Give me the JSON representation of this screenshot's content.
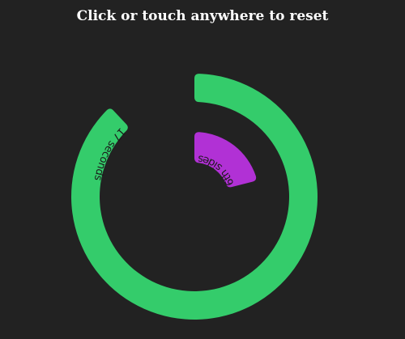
{
  "header": {
    "title": "Click or touch anywhere to reset"
  },
  "timer": {
    "outer_ring": {
      "label": "17 seconds",
      "seconds": 17,
      "progress_fraction": 0.88,
      "color": "#34cc6b"
    },
    "inner_ring": {
      "label": "6th sides",
      "progress_fraction": 0.21,
      "color": "#b131d5"
    },
    "background": "#222222"
  }
}
